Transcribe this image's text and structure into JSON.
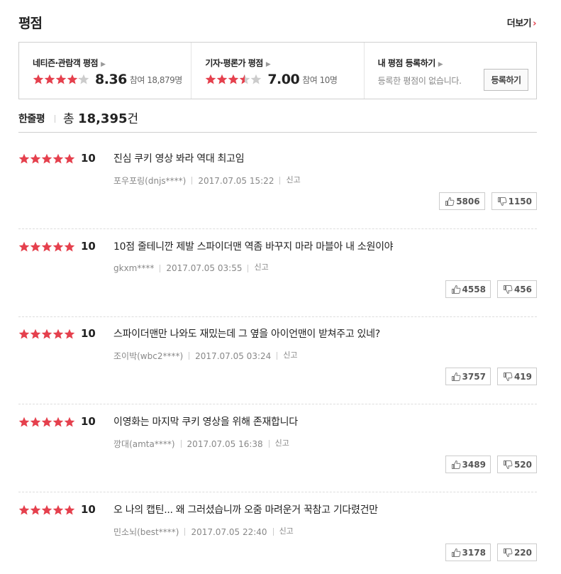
{
  "header": {
    "title": "평점",
    "more_label": "더보기",
    "more_arrow": "›"
  },
  "scores": {
    "netizen": {
      "label": "네티즌·관람객 평점",
      "rating": "8.36",
      "count": "참여 18,879명",
      "stars": [
        1,
        1,
        1,
        1,
        0.1
      ]
    },
    "critic": {
      "label": "기자·평론가 평점",
      "rating": "7.00",
      "count": "참여 10명",
      "stars": [
        1,
        1,
        1,
        0.5,
        0
      ]
    },
    "mine": {
      "label": "내 평점 등록하기",
      "info": "등록한 평점이 없습니다.",
      "button": "등록하기"
    },
    "caret": "▶"
  },
  "comments_header": {
    "title": "한줄평",
    "total_prefix": "총",
    "total": "18,395",
    "total_suffix": "건"
  },
  "reviews": [
    {
      "score": "10",
      "text": "진심 쿠키 영상 봐라 역대 최고임",
      "author": "포우포링(dnjs****)",
      "date": "2017.07.05 15:22",
      "report": "신고",
      "likes": "5806",
      "dislikes": "1150"
    },
    {
      "score": "10",
      "text": "10점 줄테니깐 제발 스파이더맨 역좀 바꾸지 마라 마블아 내 소원이야",
      "author": "gkxm****",
      "date": "2017.07.05 03:55",
      "report": "신고",
      "likes": "4558",
      "dislikes": "456"
    },
    {
      "score": "10",
      "text": "스파이더맨만 나와도 재밌는데 그 옆을 아이언맨이 받쳐주고 있네?",
      "author": "조이박(wbc2****)",
      "date": "2017.07.05 03:24",
      "report": "신고",
      "likes": "3757",
      "dislikes": "419"
    },
    {
      "score": "10",
      "text": "이영화는 마지막 쿠키 영상을 위해 존재합니다",
      "author": "깡대(amta****)",
      "date": "2017.07.05 16:38",
      "report": "신고",
      "likes": "3489",
      "dislikes": "520"
    },
    {
      "score": "10",
      "text": "오 나의 캡틴... 왜 그러셨습니까 오줌 마려운거 꾹참고 기다렸건만",
      "author": "민소뇌(best****)",
      "date": "2017.07.05 22:40",
      "report": "신고",
      "likes": "3178",
      "dislikes": "220"
    }
  ],
  "colors": {
    "star_fill": "#e5404d",
    "star_empty": "#cccccc",
    "accent": "#e5404d"
  }
}
